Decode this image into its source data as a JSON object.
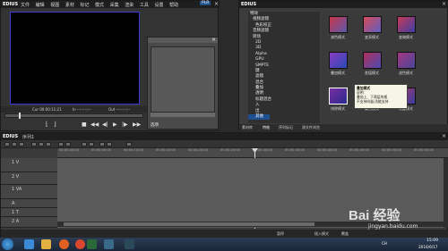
{
  "player": {
    "app_name": "EDIUS",
    "menu": [
      "文件",
      "编辑",
      "视图",
      "素材",
      "标记",
      "模式",
      "采集",
      "渲染",
      "工具",
      "设置",
      "帮助"
    ],
    "mode_badge": "PLR",
    "rec_badge": "REC",
    "timecode_in": "Cur 00:00:11;21",
    "timecode_out": "In --:--:--;--",
    "timecode_dur": "Out --:--:--;--",
    "transport_label": "Dur --:--:--;--"
  },
  "dialog": {
    "bottom_label": "选项"
  },
  "effects": {
    "app_name": "EDIUS",
    "tree": [
      "特效",
      "视频滤镜",
      "色彩校正",
      "音频滤镜",
      "转场",
      "2D",
      "3D",
      "Alpha",
      "GPU",
      "SMPTE",
      "键",
      "滤镜",
      "混合",
      "叠加",
      "透明",
      "标题混合",
      "入",
      "出",
      "混合",
      "人人人",
      "其他"
    ],
    "thumbs": [
      {
        "label": "减色模式",
        "color": "#c8344a"
      },
      {
        "label": "变亮模式",
        "color": "#d84a5a"
      },
      {
        "label": "变暗模式",
        "color": "#c63a56"
      },
      {
        "label": "叠加模式",
        "color": "#8a3cc0"
      },
      {
        "label": "差值模式",
        "color": "#b0305c"
      },
      {
        "label": "滤色模式",
        "color": "#a63680"
      },
      {
        "label": "排除模式",
        "color": "#7a2ea0"
      },
      {
        "label": "柔光模式",
        "color": "#c03a58"
      },
      {
        "label": "亮度模式",
        "color": "#a83a66"
      }
    ],
    "tooltip": {
      "title": "叠加模式",
      "line1": "说明：",
      "line2": "叠加上、下两层的视",
      "line3": "不支持向量/功能支持"
    },
    "tabs": [
      "素材库",
      "特效",
      "序列标记",
      "源文件浏览"
    ]
  },
  "timeline": {
    "app_name": "EDIUS",
    "sequence_name": "序列1",
    "ruler": [
      "00:00:00;00",
      "00:00:05;00",
      "00:00:10;00",
      "00:00:15;00",
      "00:00:20;00",
      "00:00:25;00",
      "00:00:30;00",
      "00:00:35;00",
      "00:00:40;00",
      "00:00:45;00",
      "00:00:50;00",
      "00:00:55;00"
    ],
    "tracks": [
      "1 V",
      "2 V",
      "1 VA",
      "A",
      "1 T",
      "2 A"
    ],
    "status_left": "暂停",
    "status_right1": "插入模式",
    "status_right2": "覆盖"
  },
  "taskbar": {
    "time": "15:09",
    "date": "2016/6/17",
    "lang": "CH"
  },
  "watermark": {
    "brand": "Bai 经验",
    "url": "jingyan.baidu.com"
  }
}
